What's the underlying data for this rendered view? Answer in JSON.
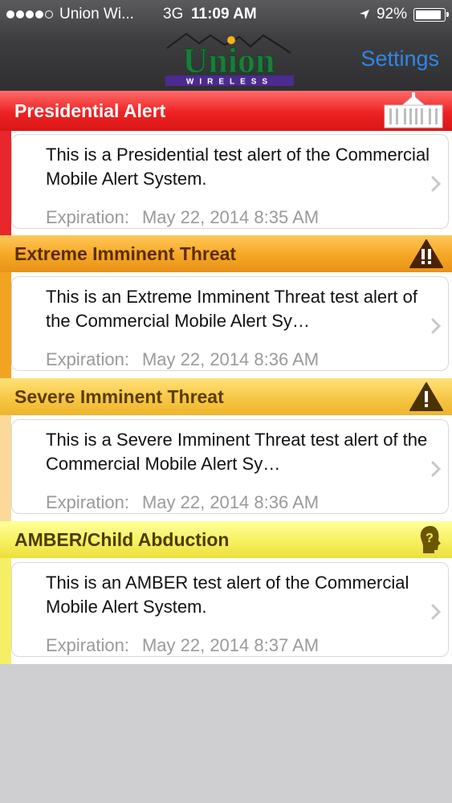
{
  "status_bar": {
    "signal_dots_filled": 4,
    "signal_dots_total": 5,
    "carrier": "Union Wi...",
    "network": "3G",
    "time": "11:09 AM",
    "battery_percent": "92%",
    "battery_level": 0.92
  },
  "nav": {
    "logo_text": "Union",
    "logo_subtext": "WIRELESS",
    "settings_label": "Settings"
  },
  "colors": {
    "settings_blue": "#2f87e8",
    "presidential_red": "#ee2222",
    "extreme_orange": "#f5a623",
    "severe_gold": "#f7c744",
    "amber_yellow": "#f7f060"
  },
  "alerts": [
    {
      "category": "Presidential Alert",
      "icon": "white-house-icon",
      "message": "This is a Presidential test alert of the Commercial Mobile Alert System.",
      "expiration_label": "Expiration:",
      "expiration_value": "May 22, 2014 8:35 AM"
    },
    {
      "category": "Extreme Imminent Threat",
      "icon": "double-exclamation-warning-icon",
      "message": "This is an Extreme Imminent Threat test alert of the Commercial Mobile Alert Sy…",
      "expiration_label": "Expiration:",
      "expiration_value": "May 22, 2014 8:36 AM"
    },
    {
      "category": "Severe Imminent Threat",
      "icon": "exclamation-warning-icon",
      "message": "This is a Severe Imminent Threat test alert of the Commercial Mobile Alert Sy…",
      "expiration_label": "Expiration:",
      "expiration_value": "May 22, 2014 8:36 AM"
    },
    {
      "category": "AMBER/Child Abduction",
      "icon": "child-question-icon",
      "message": "This is an AMBER test alert of the Commercial Mobile Alert System.",
      "expiration_label": "Expiration:",
      "expiration_value": "May 22, 2014 8:37 AM"
    }
  ]
}
